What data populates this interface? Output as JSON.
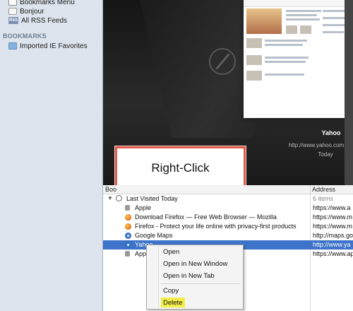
{
  "sidebar": {
    "items_top": [
      {
        "label": "Bookmarks Menu",
        "icon": "bookmarks-menu-icon"
      },
      {
        "label": "Bonjour",
        "icon": "bonjour-icon"
      },
      {
        "label": "All RSS Feeds",
        "icon": "rss-icon"
      }
    ],
    "rss_badge": "RSS",
    "section_header": "BOOKMARKS",
    "items_bookmarks": [
      {
        "label": "Imported IE Favorites",
        "icon": "folder-icon"
      }
    ]
  },
  "coverflow": {
    "title": "Yahoo",
    "url": "http://www.yahoo.com",
    "date": "Today"
  },
  "annotation": {
    "label": "Right-Click",
    "border_color": "#e25a4c"
  },
  "table": {
    "columns": [
      "Boo",
      "Address"
    ],
    "group": {
      "label": "Last Visited Today",
      "count": "6 items"
    },
    "rows": [
      {
        "name": "Apple",
        "address": "https://www.a",
        "icon": "apple-icon"
      },
      {
        "name": "Download Firefox — Free Web Browser — Mozilla",
        "address": "https://www.m",
        "icon": "firefox-icon"
      },
      {
        "name": "Firefox - Protect your life online with privacy-first products",
        "address": "https://www.m",
        "icon": "firefox-icon"
      },
      {
        "name": "Google Maps",
        "address": "http://maps.go",
        "icon": "safari-icon"
      },
      {
        "name": "Yahoo",
        "address": "http://www.ya",
        "icon": "safari-icon",
        "selected": true
      },
      {
        "name": "App",
        "address": "https://www.ap",
        "icon": "apple-icon"
      }
    ],
    "selection_color": "#3d73c8"
  },
  "context_menu": {
    "items": [
      "Open",
      "Open in New Window",
      "Open in New Tab",
      "Copy",
      "Delete"
    ],
    "highlighted": "Delete",
    "highlight_color": "#f2ee49"
  }
}
